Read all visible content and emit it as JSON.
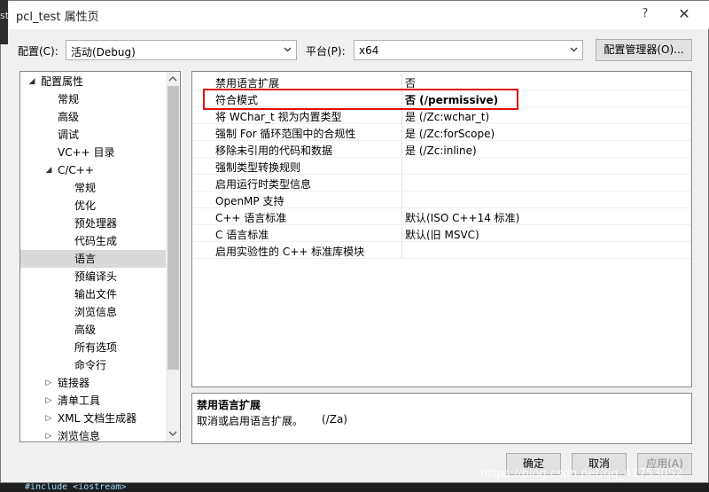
{
  "window": {
    "title": "pcl_test 属性页",
    "help": "?",
    "close": "✕",
    "edge_text": "st"
  },
  "config": {
    "config_label": "配置(C):",
    "config_value": "活动(Debug)",
    "platform_label": "平台(P):",
    "platform_value": "x64",
    "manager_button": "配置管理器(O)..."
  },
  "tree": {
    "items": [
      {
        "label": "配置属性",
        "toggle": "◢"
      },
      {
        "label": "常规"
      },
      {
        "label": "高级"
      },
      {
        "label": "调试"
      },
      {
        "label": "VC++ 目录"
      },
      {
        "label": "C/C++",
        "toggle": "◢"
      },
      {
        "label": "常规"
      },
      {
        "label": "优化"
      },
      {
        "label": "预处理器"
      },
      {
        "label": "代码生成"
      },
      {
        "label": "语言",
        "selected": true
      },
      {
        "label": "预编译头"
      },
      {
        "label": "输出文件"
      },
      {
        "label": "浏览信息"
      },
      {
        "label": "高级"
      },
      {
        "label": "所有选项"
      },
      {
        "label": "命令行"
      },
      {
        "label": "链接器",
        "toggle": "▷"
      },
      {
        "label": "清单工具",
        "toggle": "▷"
      },
      {
        "label": "XML 文档生成器",
        "toggle": "▷"
      },
      {
        "label": "浏览信息",
        "toggle": "▷"
      }
    ]
  },
  "properties": [
    {
      "name": "禁用语言扩展",
      "value": "否"
    },
    {
      "name": "符合模式",
      "value": "否 (/permissive)",
      "bold": true
    },
    {
      "name": "将 WChar_t 视为内置类型",
      "value": "是 (/Zc:wchar_t)"
    },
    {
      "name": "强制 For 循环范围中的合规性",
      "value": "是 (/Zc:forScope)"
    },
    {
      "name": "移除未引用的代码和数据",
      "value": "是 (/Zc:inline)"
    },
    {
      "name": "强制类型转换规则",
      "value": ""
    },
    {
      "name": "启用运行时类型信息",
      "value": ""
    },
    {
      "name": "OpenMP 支持",
      "value": ""
    },
    {
      "name": "C++ 语言标准",
      "value": "默认(ISO C++14 标准)"
    },
    {
      "name": "C 语言标准",
      "value": "默认(旧 MSVC)"
    },
    {
      "name": "启用实验性的 C++ 标准库模块",
      "value": ""
    }
  ],
  "description": {
    "title": "禁用语言扩展",
    "text": "取消或启用语言扩展。",
    "switch": "(/Za)"
  },
  "buttons": {
    "ok": "确定",
    "cancel": "取消",
    "apply": "应用(A)"
  },
  "background": {
    "code": "#include <iostream>",
    "watermark": "https://blog.csdn.net/qq_41753052"
  },
  "colors": {
    "highlight": "#e01010",
    "selected_row": "#d9d9d9"
  }
}
